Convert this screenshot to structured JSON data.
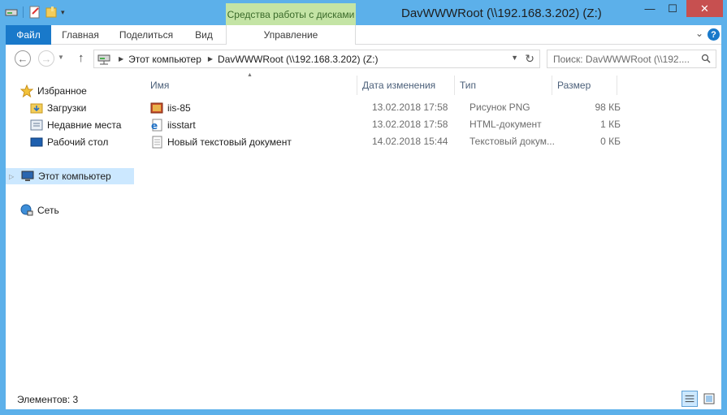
{
  "window": {
    "title": "DavWWWRoot (\\\\192.168.3.202) (Z:)",
    "contextual_tab_group": "Средства работы с дисками",
    "minimize": "—",
    "maximize": "☐",
    "close": "✕"
  },
  "ribbon": {
    "tabs": [
      {
        "label": "Файл"
      },
      {
        "label": "Главная"
      },
      {
        "label": "Поделиться"
      },
      {
        "label": "Вид"
      },
      {
        "label": "Управление"
      }
    ],
    "help": "?"
  },
  "navigation": {
    "back": "←",
    "forward": "→",
    "up": "↑",
    "breadcrumb": [
      "Этот компьютер",
      "DavWWWRoot (\\\\192.168.3.202) (Z:)"
    ],
    "search_placeholder": "Поиск: DavWWWRoot (\\\\192...."
  },
  "sidebar": {
    "items": [
      {
        "label": "Избранное",
        "icon": "star-icon"
      },
      {
        "label": "Загрузки",
        "icon": "downloads-folder-icon"
      },
      {
        "label": "Недавние места",
        "icon": "recent-places-icon"
      },
      {
        "label": "Рабочий стол",
        "icon": "desktop-icon"
      },
      {
        "label": "Этот компьютер",
        "icon": "computer-icon",
        "selected": true
      },
      {
        "label": "Сеть",
        "icon": "network-icon"
      }
    ]
  },
  "file_list": {
    "columns": [
      "Имя",
      "Дата изменения",
      "Тип",
      "Размер"
    ],
    "rows": [
      {
        "name": "iis-85",
        "date": "13.02.2018 17:58",
        "type": "Рисунок PNG",
        "size": "98 КБ",
        "icon": "png-image-icon"
      },
      {
        "name": "iisstart",
        "date": "13.02.2018 17:58",
        "type": "HTML-документ",
        "size": "1 КБ",
        "icon": "html-document-icon"
      },
      {
        "name": "Новый текстовый документ",
        "date": "14.02.2018 15:44",
        "type": "Текстовый докум...",
        "size": "0 КБ",
        "icon": "text-document-icon"
      }
    ]
  },
  "status": {
    "item_count": "Элементов: 3"
  },
  "colors": {
    "frame": "#5cb0ea",
    "file_tab": "#1979ca",
    "contextual_tab": "#c4e4a5",
    "selection": "#cce8ff",
    "close_button": "#c75050"
  }
}
